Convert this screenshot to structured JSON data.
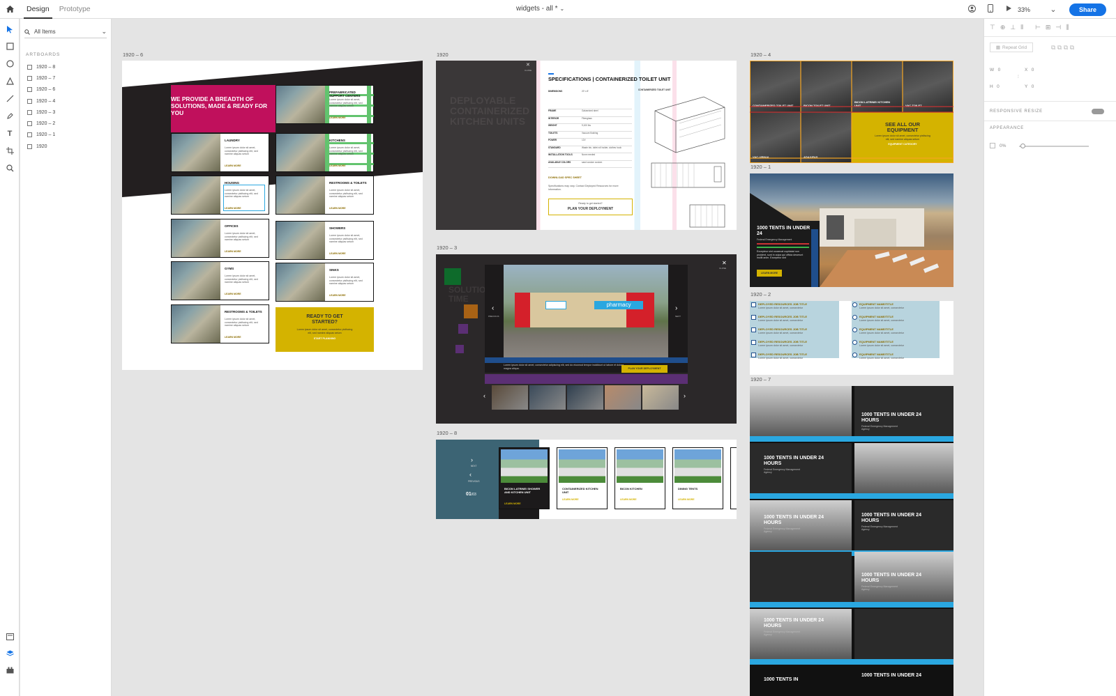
{
  "app": {
    "modes": [
      "Design",
      "Prototype"
    ],
    "active_mode": "Design",
    "doc_title": "widgets - all *",
    "zoom": "33%",
    "share_label": "Share"
  },
  "layers": {
    "search_placeholder": "All Items",
    "section_title": "ARTBOARDS",
    "items": [
      "1920 – 8",
      "1920 – 7",
      "1920 – 6",
      "1920 – 4",
      "1920 – 3",
      "1920 – 2",
      "1920 – 1",
      "1920"
    ]
  },
  "props": {
    "repeat_grid": "Repeat Grid",
    "w_label": "W",
    "w_value": "0",
    "h_label": "H",
    "h_value": "0",
    "x_label": "X",
    "x_value": "0",
    "y_label": "Y",
    "y_value": "0",
    "responsive_resize": "RESPONSIVE RESIZE",
    "appearance": "APPEARANCE",
    "opacity": "0%"
  },
  "artboards": {
    "ab6": {
      "label": "1920 – 6",
      "hero": "WE PROVIDE A BREADTH OF SOLUTIONS, MADE & READY FOR YOU",
      "cards": [
        {
          "title": "PREFABRICATED SUPPORT CENTERS"
        },
        {
          "title": "LAUNDRY"
        },
        {
          "title": "KITCHENS"
        },
        {
          "title": "HOUSING"
        },
        {
          "title": "RESTROOMS & TOILETS"
        },
        {
          "title": "OFFICES"
        },
        {
          "title": "SHOWERS"
        },
        {
          "title": "GYMS"
        },
        {
          "title": "SINKS"
        },
        {
          "title": "RESTROOMS & TOILETS"
        }
      ],
      "lorem": "Lorem ipsum dolor sit amet, consectetur pisfiscing elit, sed namine aliquas setum",
      "learn_more": "LEARN MORE",
      "cta_title": "READY TO GET STARTED?",
      "cta_text": "Lorem ipsum dolor sit amet, consectetur pisfiscing elit, sed namine aliquas setum",
      "cta_link": "START PLANNING"
    },
    "ab0": {
      "label": "1920",
      "bg_title": "DEPLOYABLE CONTAINERIZED KITCHEN UNITS",
      "spec_title": "SPECIFICATIONS | CONTAINERIZED TOILET UNIT",
      "close": "CLOSE",
      "rows": [
        {
          "k": "DIMENSIONS",
          "v": "20' x 8'"
        },
        {
          "k": "FRAME",
          "v": "Galvanized steel"
        },
        {
          "k": "INTERIOR",
          "v": "Fiberglass"
        },
        {
          "k": "WEIGHT",
          "v": "9,100 lbs"
        },
        {
          "k": "TOILETS",
          "v": "Vacuum flushing"
        },
        {
          "k": "POWER",
          "v": "12V"
        },
        {
          "k": "STANDARD",
          "v": "Waste bin, toilet roll holder, clothes hook"
        },
        {
          "k": "INSTALLATION TOOLS",
          "v": "None needed"
        },
        {
          "k": "AVAILABLE COLORS",
          "v": "sand  custom  custom"
        }
      ],
      "download": "DOWNLOAD SPEC SHEET",
      "note": "Specifications may vary. Contact Deployed Resources for more information.",
      "ready": "Ready to get started?",
      "plan": "PLAN YOUR DEPLOYMENT",
      "drawing_title": "CONTAINERIZED TOILET UNIT"
    },
    "ab3": {
      "label": "1920 – 3",
      "close": "CLOSE",
      "prev": "PREVIOUS",
      "next": "NEXT",
      "caption": "Lorem ipsum dolor sit amet, consectetur adipiscing elit, sed do eiusmod tempor incididunt ut labore et dolore magna aliqua.",
      "plan": "PLAN YOUR DEPLOYMENT",
      "sign": "pharmacy",
      "bg_title": "SOLUTIONS YOU TIME"
    },
    "ab8": {
      "label": "1920 – 8",
      "next": "NEXT",
      "previous": "PREVIOUS",
      "page": "01",
      "total": "/03",
      "cards": [
        {
          "title": "BICON LATRINE/ SHOWER AND KITCHEN UNIT"
        },
        {
          "title": "CONTAINERIZED KITCHEN UNIT"
        },
        {
          "title": "BICON KITCHEN"
        },
        {
          "title": "DINING TENTS"
        }
      ],
      "learn_more": "LEARN MORE"
    },
    "ab4": {
      "label": "1920 – 4",
      "tiles": [
        "CONTAINERIZED TOILET UNIT",
        "BICON TOILET UNIT",
        "BICON LATRINE/ KITCHEN UNIT",
        "VAC-TOILET",
        "VAC-URINAL",
        "ADA/UFAS"
      ],
      "cta_title": "SEE ALL OUR EQUIPMENT",
      "cta_text": "Lorem ipsum dolor sit amet, consectetur pisfiscing elit, sed namine aliquas setum",
      "cta_link": "EQUIPMENT CATEGORY"
    },
    "ab1": {
      "label": "1920 – 1",
      "title": "1000 TENTS IN UNDER 24",
      "subtitle": "Federal Emergency Management",
      "text": "Excepteur sint occaecat cupidatat non proident, sunt in culpa qui officia deserunt mollit anim. Excepteur sint",
      "btn": "LEARN MORE"
    },
    "ab2": {
      "label": "1920 – 2",
      "left_item": "DEPLOYED RESOURCES JOB TITLE",
      "right_item": "EQUIPMENT NAME/TITLE",
      "lorem": "Lorem ipsum dolor sit amet, consectetur"
    },
    "ab7": {
      "label": "1920 – 7",
      "tiles": [
        {
          "title": "1000 TENTS IN UNDER 24 HOURS",
          "sub": "Federal Emergency Management Agency"
        },
        {
          "title": "1000 TENTS IN UNDER 24 HOURS",
          "sub": "Federal Emergency Management Agency"
        },
        {
          "title": "1000 TENTS IN UNDER 24 HOURS",
          "sub": "Federal Emergency Management Agency"
        },
        {
          "title": "1000 TENTS IN UNDER 24 HOURS",
          "sub": "Federal Emergency Management Agency"
        },
        {
          "title": "1000 TENTS IN UNDER 24 HOURS",
          "sub": "Federal Emergency Management Agency"
        },
        {
          "title": "1000 TENTS IN UNDER 24 HOURS",
          "sub": "Federal Emergency Management Agency"
        },
        {
          "title": "1000 TENTS IN",
          "sub": ""
        },
        {
          "title": "1000 TENTS IN UNDER 24",
          "sub": ""
        }
      ]
    }
  },
  "colors": {
    "accent": "#1473e6",
    "magenta": "#c0105c",
    "gold": "#d4b300",
    "green": "#3bb54a",
    "teal_panel": "#3c6474",
    "sky_blue": "#2aa7e0",
    "light_blue_panel": "#b8d4de"
  }
}
